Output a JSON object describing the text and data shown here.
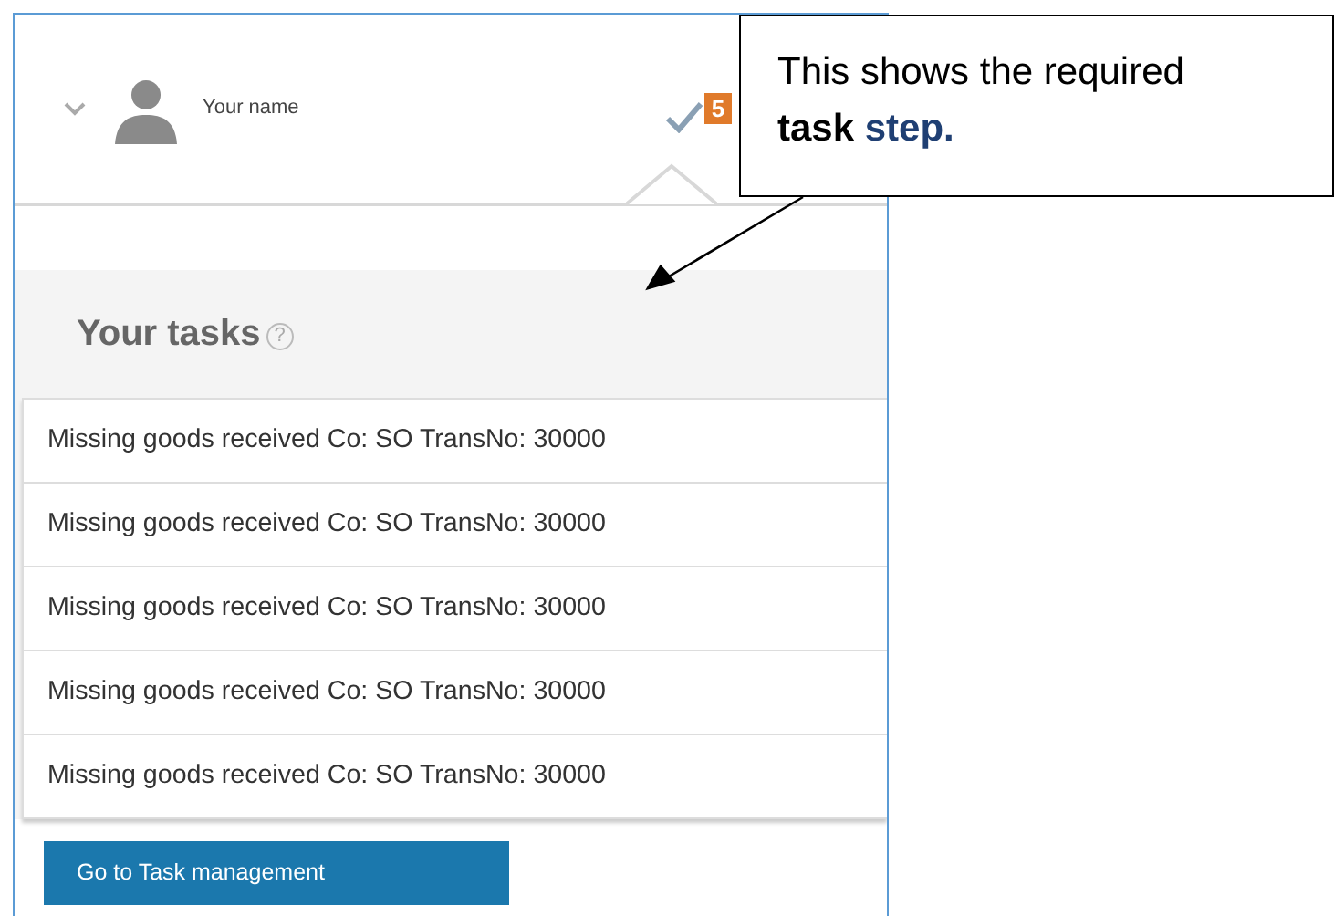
{
  "header": {
    "user_name": "Your name",
    "task_count": "5"
  },
  "tasks_panel": {
    "title": "Your tasks",
    "help": "?",
    "tasks": [
      "Missing goods received Co: SO TransNo: 30000",
      "Missing goods received Co: SO TransNo: 30000",
      "Missing goods received Co: SO TransNo: 30000",
      "Missing goods received Co: SO TransNo: 30000",
      "Missing goods received Co: SO TransNo: 30000"
    ],
    "button": "Go to Task management"
  },
  "callout": {
    "text": "This shows the required **task**",
    "highlight": "step."
  }
}
